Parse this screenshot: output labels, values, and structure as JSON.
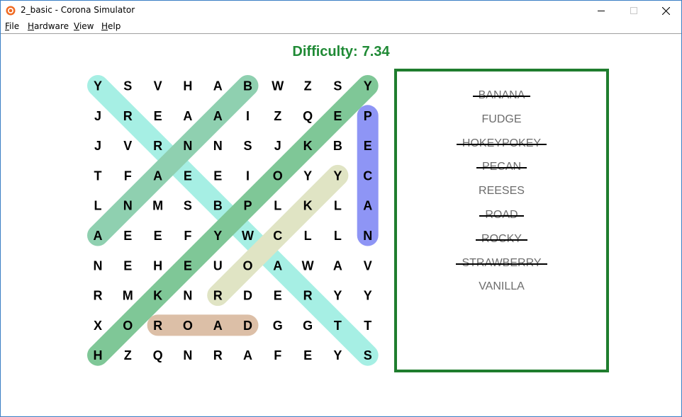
{
  "window": {
    "title": "2_basic - Corona Simulator"
  },
  "menu": {
    "file": "F",
    "file_rest": "ile",
    "hardware": "H",
    "hardware_rest": "ardware",
    "view": "V",
    "view_rest": "iew",
    "help": "H",
    "help_rest": "elp"
  },
  "game": {
    "difficulty_label": "Difficulty:",
    "difficulty_value": "7.34",
    "grid": [
      [
        "Y",
        "S",
        "V",
        "H",
        "A",
        "B",
        "W",
        "Z",
        "S",
        "Y"
      ],
      [
        "J",
        "R",
        "E",
        "A",
        "A",
        "I",
        "Z",
        "Q",
        "E",
        "P"
      ],
      [
        "J",
        "V",
        "R",
        "N",
        "N",
        "S",
        "J",
        "K",
        "B",
        "E"
      ],
      [
        "T",
        "F",
        "A",
        "E",
        "E",
        "I",
        "O",
        "Y",
        "Y",
        "C"
      ],
      [
        "L",
        "N",
        "M",
        "S",
        "B",
        "P",
        "L",
        "K",
        "L",
        "A"
      ],
      [
        "A",
        "E",
        "E",
        "F",
        "Y",
        "W",
        "C",
        "L",
        "L",
        "N"
      ],
      [
        "N",
        "E",
        "H",
        "E",
        "U",
        "O",
        "A",
        "W",
        "A",
        "V"
      ],
      [
        "R",
        "M",
        "K",
        "N",
        "R",
        "D",
        "E",
        "R",
        "Y",
        "Y"
      ],
      [
        "X",
        "O",
        "R",
        "O",
        "A",
        "D",
        "G",
        "G",
        "T",
        "T"
      ],
      [
        "H",
        "Z",
        "Q",
        "N",
        "R",
        "A",
        "F",
        "E",
        "Y",
        "S"
      ]
    ],
    "highlights": [
      {
        "word": "STRAWBERRY",
        "from": [
          9,
          9
        ],
        "to": [
          0,
          0
        ],
        "color": "#a6efe4"
      },
      {
        "word": "BANANA",
        "from": [
          0,
          5
        ],
        "to": [
          5,
          0
        ],
        "color": "#8fd0b0"
      },
      {
        "word": "HOKEYPOKEY",
        "from": [
          9,
          0
        ],
        "to": [
          0,
          9
        ],
        "color": "#7fc797"
      },
      {
        "word": "ROCKY",
        "from": [
          7,
          4
        ],
        "to": [
          3,
          8
        ],
        "color": "#e0e4c4"
      },
      {
        "word": "PECAN",
        "from": [
          1,
          9
        ],
        "to": [
          5,
          9
        ],
        "color": "#8e95f5"
      },
      {
        "word": "ROAD",
        "from": [
          8,
          2
        ],
        "to": [
          8,
          5
        ],
        "color": "#dcbfa7"
      }
    ],
    "words": [
      {
        "text": "BANANA",
        "found": true
      },
      {
        "text": "FUDGE",
        "found": false
      },
      {
        "text": "HOKEYPOKEY",
        "found": true
      },
      {
        "text": "PECAN",
        "found": true
      },
      {
        "text": "REESES",
        "found": false
      },
      {
        "text": "ROAD",
        "found": true
      },
      {
        "text": "ROCKY",
        "found": true
      },
      {
        "text": "STRAWBERRY",
        "found": true
      },
      {
        "text": "VANILLA",
        "found": false
      }
    ]
  }
}
